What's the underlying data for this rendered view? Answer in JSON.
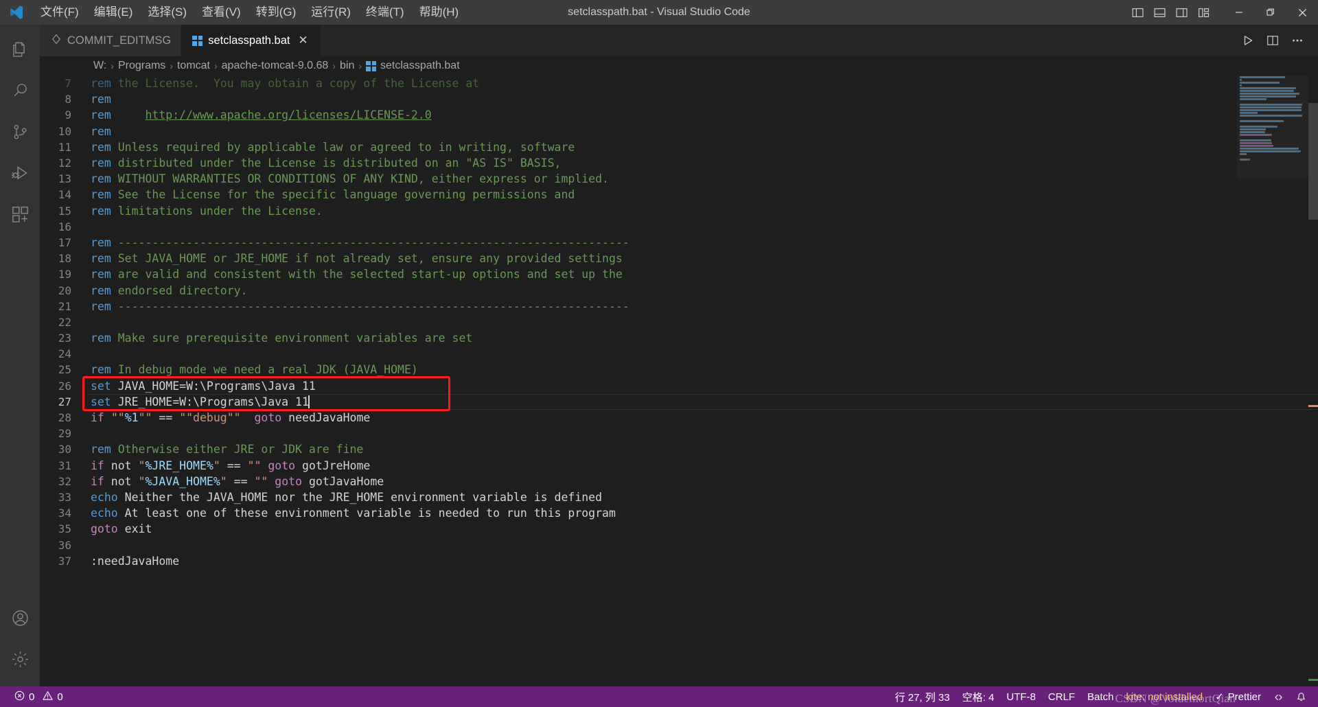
{
  "window": {
    "title": "setclasspath.bat - Visual Studio Code",
    "logo_name": "vscode-logo"
  },
  "menu": {
    "items": [
      {
        "label": "文件(F)"
      },
      {
        "label": "编辑(E)"
      },
      {
        "label": "选择(S)"
      },
      {
        "label": "查看(V)"
      },
      {
        "label": "转到(G)"
      },
      {
        "label": "运行(R)"
      },
      {
        "label": "终端(T)"
      },
      {
        "label": "帮助(H)"
      }
    ]
  },
  "layout_buttons": [
    {
      "name": "toggle-primary-sidebar-icon"
    },
    {
      "name": "toggle-panel-icon"
    },
    {
      "name": "toggle-secondary-sidebar-icon"
    },
    {
      "name": "customize-layout-icon"
    }
  ],
  "window_controls": [
    {
      "name": "minimize-button",
      "glyph": "─"
    },
    {
      "name": "restore-button",
      "glyph": "❐"
    },
    {
      "name": "close-button",
      "glyph": "✕"
    }
  ],
  "activitybar": {
    "items": [
      {
        "name": "explorer-icon",
        "label": "资源管理器"
      },
      {
        "name": "search-icon",
        "label": "搜索"
      },
      {
        "name": "source-control-icon",
        "label": "源代码管理"
      },
      {
        "name": "run-and-debug-icon",
        "label": "运行和调试"
      },
      {
        "name": "extensions-icon",
        "label": "扩展"
      }
    ],
    "bottom_items": [
      {
        "name": "accounts-icon",
        "label": "账户"
      },
      {
        "name": "settings-gear-icon",
        "label": "管理"
      }
    ]
  },
  "tabs": [
    {
      "label": "COMMIT_EDITMSG",
      "icon": "git-commit-icon",
      "active": false,
      "closable": false
    },
    {
      "label": "setclasspath.bat",
      "icon": "windows-bat-icon",
      "active": true,
      "closable": true,
      "close_glyph": "✕"
    }
  ],
  "editor_actions": [
    {
      "name": "run-button",
      "glyph": "▷"
    },
    {
      "name": "split-editor-right-button",
      "glyph": "▫"
    },
    {
      "name": "more-actions-button",
      "glyph": "⋯"
    }
  ],
  "breadcrumb": {
    "separator": "›",
    "items": [
      {
        "label": "W:"
      },
      {
        "label": "Programs"
      },
      {
        "label": "tomcat"
      },
      {
        "label": "apache-tomcat-9.0.68"
      },
      {
        "label": "bin"
      },
      {
        "label": "setclasspath.bat",
        "icon": "windows-bat-icon"
      }
    ]
  },
  "editor": {
    "first_visible_line": 7,
    "cursor_line": 27,
    "highlight_box": {
      "from_line": 26,
      "to_line": 27,
      "color": "#ff1a1a"
    },
    "lines": [
      {
        "n": 7,
        "partial": true,
        "tokens": [
          {
            "t": "rem",
            "c": "kw"
          },
          {
            "t": " the License.  You may obtain a copy of the License at",
            "c": "cmt"
          }
        ]
      },
      {
        "n": 8,
        "tokens": [
          {
            "t": "rem",
            "c": "kw"
          }
        ]
      },
      {
        "n": 9,
        "tokens": [
          {
            "t": "rem",
            "c": "kw"
          },
          {
            "t": "     ",
            "c": "cmt"
          },
          {
            "t": "http://www.apache.org/licenses/LICENSE-2.0",
            "c": "link"
          }
        ]
      },
      {
        "n": 10,
        "tokens": [
          {
            "t": "rem",
            "c": "kw"
          }
        ]
      },
      {
        "n": 11,
        "tokens": [
          {
            "t": "rem",
            "c": "kw"
          },
          {
            "t": " Unless required by applicable law or agreed to in writing, software",
            "c": "cmt"
          }
        ]
      },
      {
        "n": 12,
        "tokens": [
          {
            "t": "rem",
            "c": "kw"
          },
          {
            "t": " distributed under the License is distributed on an \"AS IS\" BASIS,",
            "c": "cmt"
          }
        ]
      },
      {
        "n": 13,
        "tokens": [
          {
            "t": "rem",
            "c": "kw"
          },
          {
            "t": " WITHOUT WARRANTIES OR CONDITIONS OF ANY KIND, either express or implied.",
            "c": "cmt"
          }
        ]
      },
      {
        "n": 14,
        "tokens": [
          {
            "t": "rem",
            "c": "kw"
          },
          {
            "t": " See the License for the specific language governing permissions and",
            "c": "cmt"
          }
        ]
      },
      {
        "n": 15,
        "tokens": [
          {
            "t": "rem",
            "c": "kw"
          },
          {
            "t": " limitations under the License.",
            "c": "cmt"
          }
        ]
      },
      {
        "n": 16,
        "tokens": []
      },
      {
        "n": 17,
        "tokens": [
          {
            "t": "rem",
            "c": "kw"
          },
          {
            "t": " ---------------------------------------------------------------------------",
            "c": "cmt"
          }
        ]
      },
      {
        "n": 18,
        "tokens": [
          {
            "t": "rem",
            "c": "kw"
          },
          {
            "t": " Set JAVA_HOME or JRE_HOME if not already set, ensure any provided settings",
            "c": "cmt"
          }
        ]
      },
      {
        "n": 19,
        "tokens": [
          {
            "t": "rem",
            "c": "kw"
          },
          {
            "t": " are valid and consistent with the selected start-up options and set up the",
            "c": "cmt"
          }
        ]
      },
      {
        "n": 20,
        "tokens": [
          {
            "t": "rem",
            "c": "kw"
          },
          {
            "t": " endorsed directory.",
            "c": "cmt"
          }
        ]
      },
      {
        "n": 21,
        "tokens": [
          {
            "t": "rem",
            "c": "kw"
          },
          {
            "t": " ---------------------------------------------------------------------------",
            "c": "cmt"
          }
        ]
      },
      {
        "n": 22,
        "tokens": []
      },
      {
        "n": 23,
        "tokens": [
          {
            "t": "rem",
            "c": "kw"
          },
          {
            "t": " Make sure prerequisite environment variables are set",
            "c": "cmt"
          }
        ]
      },
      {
        "n": 24,
        "tokens": []
      },
      {
        "n": 25,
        "tokens": [
          {
            "t": "rem",
            "c": "kw"
          },
          {
            "t": " In debug mode we need a real JDK (JAVA_HOME)",
            "c": "cmt"
          }
        ]
      },
      {
        "n": 26,
        "tokens": [
          {
            "t": "set",
            "c": "kw"
          },
          {
            "t": " JAVA_HOME=W:\\Programs\\Java 11",
            "c": "txt"
          }
        ]
      },
      {
        "n": 27,
        "tokens": [
          {
            "t": "set",
            "c": "kw"
          },
          {
            "t": " JRE_HOME=W:\\Programs\\Java 11",
            "c": "txt"
          }
        ],
        "caret_after": true
      },
      {
        "n": 28,
        "tokens": [
          {
            "t": "if",
            "c": "ctrl"
          },
          {
            "t": " ",
            "c": "txt"
          },
          {
            "t": "\"\"",
            "c": "str"
          },
          {
            "t": "%1",
            "c": "var"
          },
          {
            "t": "\"\"",
            "c": "str"
          },
          {
            "t": " == ",
            "c": "op"
          },
          {
            "t": "\"\"debug\"\"",
            "c": "str"
          },
          {
            "t": "  ",
            "c": "txt"
          },
          {
            "t": "goto",
            "c": "ctrl"
          },
          {
            "t": " needJavaHome",
            "c": "txt"
          }
        ]
      },
      {
        "n": 29,
        "tokens": []
      },
      {
        "n": 30,
        "tokens": [
          {
            "t": "rem",
            "c": "kw"
          },
          {
            "t": " Otherwise either JRE or JDK are fine",
            "c": "cmt"
          }
        ]
      },
      {
        "n": 31,
        "tokens": [
          {
            "t": "if",
            "c": "ctrl"
          },
          {
            "t": " not ",
            "c": "txt"
          },
          {
            "t": "\"",
            "c": "str"
          },
          {
            "t": "%JRE_HOME%",
            "c": "var"
          },
          {
            "t": "\"",
            "c": "str"
          },
          {
            "t": " == ",
            "c": "op"
          },
          {
            "t": "\"\"",
            "c": "str"
          },
          {
            "t": " ",
            "c": "txt"
          },
          {
            "t": "goto",
            "c": "ctrl"
          },
          {
            "t": " gotJreHome",
            "c": "txt"
          }
        ]
      },
      {
        "n": 32,
        "tokens": [
          {
            "t": "if",
            "c": "ctrl"
          },
          {
            "t": " not ",
            "c": "txt"
          },
          {
            "t": "\"",
            "c": "str"
          },
          {
            "t": "%JAVA_HOME%",
            "c": "var"
          },
          {
            "t": "\"",
            "c": "str"
          },
          {
            "t": " == ",
            "c": "op"
          },
          {
            "t": "\"\"",
            "c": "str"
          },
          {
            "t": " ",
            "c": "txt"
          },
          {
            "t": "goto",
            "c": "ctrl"
          },
          {
            "t": " gotJavaHome",
            "c": "txt"
          }
        ]
      },
      {
        "n": 33,
        "tokens": [
          {
            "t": "echo",
            "c": "kw"
          },
          {
            "t": " Neither the JAVA_HOME nor the JRE_HOME environment variable is defined",
            "c": "txt"
          }
        ]
      },
      {
        "n": 34,
        "tokens": [
          {
            "t": "echo",
            "c": "kw"
          },
          {
            "t": " At least one of these environment variable is needed to run this program",
            "c": "txt"
          }
        ]
      },
      {
        "n": 35,
        "tokens": [
          {
            "t": "goto",
            "c": "ctrl"
          },
          {
            "t": " exit",
            "c": "txt"
          }
        ]
      },
      {
        "n": 36,
        "tokens": []
      },
      {
        "n": 37,
        "tokens": [
          {
            "t": ":needJavaHome",
            "c": "label"
          }
        ]
      }
    ]
  },
  "statusbar": {
    "background": "#68217a",
    "problems": {
      "error_icon": "error-circle-icon",
      "errors": "0",
      "warning_icon": "warning-triangle-icon",
      "warnings": "0"
    },
    "right_items": [
      {
        "name": "editor-position",
        "label": "行 27, 列 33"
      },
      {
        "name": "editor-indentation",
        "label": "空格: 4"
      },
      {
        "name": "editor-encoding",
        "label": "UTF-8"
      },
      {
        "name": "editor-eol",
        "label": "CRLF"
      },
      {
        "name": "editor-language",
        "label": "Batch"
      },
      {
        "name": "kite-status",
        "label": "kite: not installed",
        "warn": true
      },
      {
        "name": "prettier-status",
        "label": "Prettier",
        "check": "✓"
      },
      {
        "name": "remote-indicator",
        "label": ""
      },
      {
        "name": "notifications-bell",
        "label": ""
      }
    ],
    "watermark": "CSDN @VoldemortQian"
  }
}
